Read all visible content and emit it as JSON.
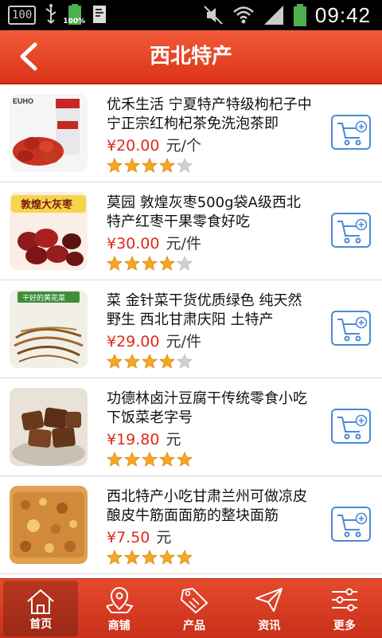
{
  "status_bar": {
    "left_badge": "100",
    "battery_small_label": "100%",
    "right_battery_color": "#4caf50",
    "time": "09:42"
  },
  "header": {
    "title": "西北特产",
    "back_icon": "chevron-left-icon"
  },
  "products": [
    {
      "name": "优禾生活 宁夏特产特级枸杞子中宁正宗红枸杞茶免洗泡茶即",
      "price": "¥20.00",
      "unit": "元/个",
      "rating": 4,
      "thumb_label": "EUHO"
    },
    {
      "name": "莫园 敦煌灰枣500g袋A级西北特产红枣干果零食好吃",
      "price": "¥30.00",
      "unit": "元/件",
      "rating": 4,
      "thumb_label": "敦煌大灰枣"
    },
    {
      "name": "菜 金针菜干货优质绿色 纯天然野生 西北甘肃庆阳 土特产",
      "price": "¥29.00",
      "unit": "元/件",
      "rating": 4,
      "thumb_label": "干好的黄花菜"
    },
    {
      "name": "功德林卤汁豆腐干传统零食小吃下饭菜老字号",
      "price": "¥19.80",
      "unit": "元",
      "rating": 5,
      "thumb_label": ""
    },
    {
      "name": "西北特产小吃甘肃兰州可做凉皮酿皮牛筋面面筋的整块面筋",
      "price": "¥7.50",
      "unit": "元",
      "rating": 5,
      "thumb_label": ""
    }
  ],
  "tabs": [
    {
      "label": "首页",
      "icon": "home-icon",
      "active": true
    },
    {
      "label": "商铺",
      "icon": "map-pin-icon",
      "active": false
    },
    {
      "label": "产品",
      "icon": "sale-tag-icon",
      "active": false
    },
    {
      "label": "资讯",
      "icon": "send-icon",
      "active": false
    },
    {
      "label": "更多",
      "icon": "sliders-icon",
      "active": false
    }
  ],
  "colors": {
    "header_red": "#e8442a",
    "price_red": "#e02a1a",
    "cart_blue": "#4a8ad6",
    "star_gold": "#f5a623",
    "star_empty": "#d0d0d0"
  }
}
